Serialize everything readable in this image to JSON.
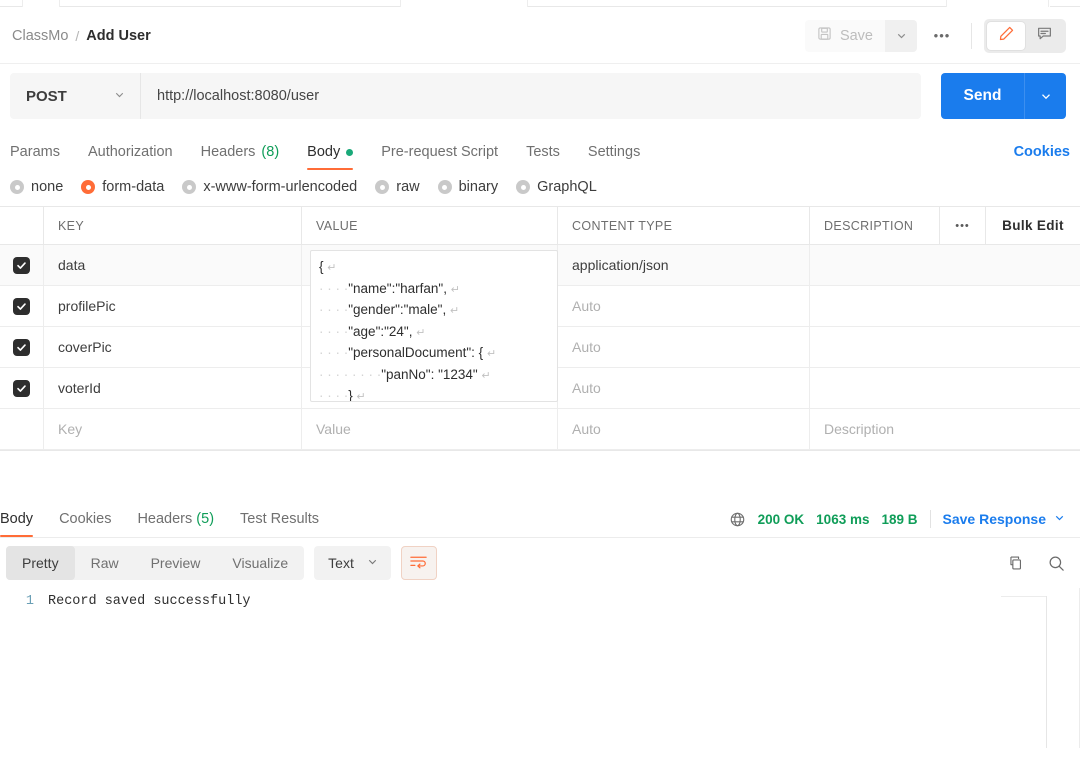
{
  "header": {
    "breadcrumb_root": "ClassMo",
    "breadcrumb_sep": "/",
    "breadcrumb_current": "Add User",
    "save_label": "Save",
    "save_caret_icon": "chevron-down-icon",
    "more_label": "•••",
    "edit_icon": "pencil-icon",
    "comment_icon": "comment-icon"
  },
  "request": {
    "method": "POST",
    "method_caret_icon": "chevron-down-icon",
    "url": "http://localhost:8080/user",
    "send_label": "Send",
    "send_caret_icon": "chevron-down-icon",
    "cookies_label": "Cookies",
    "tabs": [
      {
        "label": "Params",
        "count": "",
        "active": false,
        "dot": false
      },
      {
        "label": "Authorization",
        "count": "",
        "active": false,
        "dot": false
      },
      {
        "label": "Headers",
        "count": "(8)",
        "active": false,
        "dot": false
      },
      {
        "label": "Body",
        "count": "",
        "active": true,
        "dot": true
      },
      {
        "label": "Pre-request Script",
        "count": "",
        "active": false,
        "dot": false
      },
      {
        "label": "Tests",
        "count": "",
        "active": false,
        "dot": false
      },
      {
        "label": "Settings",
        "count": "",
        "active": false,
        "dot": false
      }
    ],
    "body_types": [
      {
        "label": "none",
        "selected": false
      },
      {
        "label": "form-data",
        "selected": true
      },
      {
        "label": "x-www-form-urlencoded",
        "selected": false
      },
      {
        "label": "raw",
        "selected": false
      },
      {
        "label": "binary",
        "selected": false
      },
      {
        "label": "GraphQL",
        "selected": false
      }
    ],
    "table": {
      "columns": [
        "KEY",
        "VALUE",
        "CONTENT TYPE",
        "DESCRIPTION"
      ],
      "menu_label": "•••",
      "bulk_edit_label": "Bulk Edit",
      "rows": [
        {
          "checked": true,
          "key": "data",
          "value": "",
          "content_type": "application/json",
          "description": ""
        },
        {
          "checked": true,
          "key": "profilePic",
          "value": "",
          "content_type": "Auto",
          "description": ""
        },
        {
          "checked": true,
          "key": "coverPic",
          "value": "",
          "content_type": "Auto",
          "description": ""
        },
        {
          "checked": true,
          "key": "voterId",
          "value": "",
          "content_type": "Auto",
          "description": ""
        }
      ],
      "placeholder_row": {
        "key": "Key",
        "value": "Value",
        "content_type": "Auto",
        "description": "Description"
      }
    },
    "json_editor": {
      "line1": "{",
      "line2": "\"name\":\"harfan\",",
      "line3": "\"gender\":\"male\",",
      "line4": "\"age\":\"24\",",
      "line5": "\"personalDocument\": {",
      "line6": "\"panNo\": \"1234\"",
      "line7": "}",
      "line8": "}",
      "return_glyph": "↵"
    }
  },
  "response": {
    "tabs": [
      {
        "label": "Body",
        "count": "",
        "active": true
      },
      {
        "label": "Cookies",
        "count": "",
        "active": false
      },
      {
        "label": "Headers",
        "count": "(5)",
        "active": false
      },
      {
        "label": "Test Results",
        "count": "",
        "active": false
      }
    ],
    "globe_icon": "globe-icon",
    "status": "200 OK",
    "time": "1063 ms",
    "size": "189 B",
    "save_response_label": "Save Response",
    "save_response_caret_icon": "chevron-down-icon",
    "view_modes": [
      {
        "label": "Pretty",
        "active": true
      },
      {
        "label": "Raw",
        "active": false
      },
      {
        "label": "Preview",
        "active": false
      },
      {
        "label": "Visualize",
        "active": false
      }
    ],
    "format": "Text",
    "format_caret_icon": "chevron-down-icon",
    "wrap_icon": "word-wrap-icon",
    "copy_icon": "copy-icon",
    "search_icon": "search-icon",
    "body_lines": [
      {
        "number": "1",
        "text": "Record saved successfully"
      }
    ]
  },
  "colors": {
    "accent_orange": "#ff6c37",
    "send_blue": "#1a7ced",
    "status_green": "#0f9d58",
    "link_blue": "#1a7ced"
  }
}
